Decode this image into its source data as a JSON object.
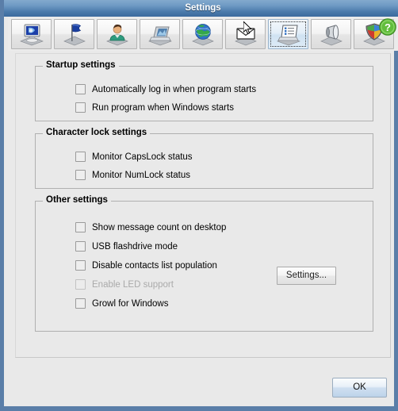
{
  "window": {
    "title": "Settings",
    "frame_color": "#5a7ea8",
    "titlebar_gradient_top": "#82a9cd",
    "titlebar_gradient_bottom": "#3e6da0",
    "background": "#e9e9e9"
  },
  "toolbar": {
    "tabs": [
      {
        "name": "tab-general",
        "icon": "monitor-icon",
        "selected": false
      },
      {
        "name": "tab-status",
        "icon": "flag-icon",
        "selected": false
      },
      {
        "name": "tab-account",
        "icon": "person-icon",
        "selected": false
      },
      {
        "name": "tab-display",
        "icon": "laptop-icon",
        "selected": false
      },
      {
        "name": "tab-network",
        "icon": "globe-icon",
        "selected": false
      },
      {
        "name": "tab-messages",
        "icon": "envelope-icon",
        "selected": false
      },
      {
        "name": "tab-advanced",
        "icon": "list-document-icon",
        "selected": true
      },
      {
        "name": "tab-sounds",
        "icon": "speaker-icon",
        "selected": false
      },
      {
        "name": "tab-security",
        "icon": "shield-icon",
        "selected": false
      }
    ],
    "help": {
      "icon": "help-question-icon",
      "label": "?",
      "color": "#5db83a"
    }
  },
  "groups": [
    {
      "name": "startup-settings",
      "title": "Startup settings",
      "items": [
        {
          "label": "Automatically log in when program starts",
          "checked": false,
          "enabled": true
        },
        {
          "label": "Run program when Windows starts",
          "checked": false,
          "enabled": true
        }
      ]
    },
    {
      "name": "character-lock-settings",
      "title": "Character lock settings",
      "items": [
        {
          "label": "Monitor CapsLock status",
          "checked": false,
          "enabled": true
        },
        {
          "label": "Monitor NumLock status",
          "checked": false,
          "enabled": true
        }
      ]
    },
    {
      "name": "other-settings",
      "title": "Other settings",
      "items": [
        {
          "label": "Show message count on desktop",
          "checked": false,
          "enabled": true
        },
        {
          "label": "USB flashdrive mode",
          "checked": false,
          "enabled": true
        },
        {
          "label": "Disable contacts list population",
          "checked": false,
          "enabled": true
        },
        {
          "label": "Enable LED support",
          "checked": false,
          "enabled": false
        },
        {
          "label": "Growl for Windows",
          "checked": false,
          "enabled": true
        }
      ]
    }
  ],
  "buttons": {
    "settings_label": "Settings...",
    "ok_label": "OK"
  }
}
